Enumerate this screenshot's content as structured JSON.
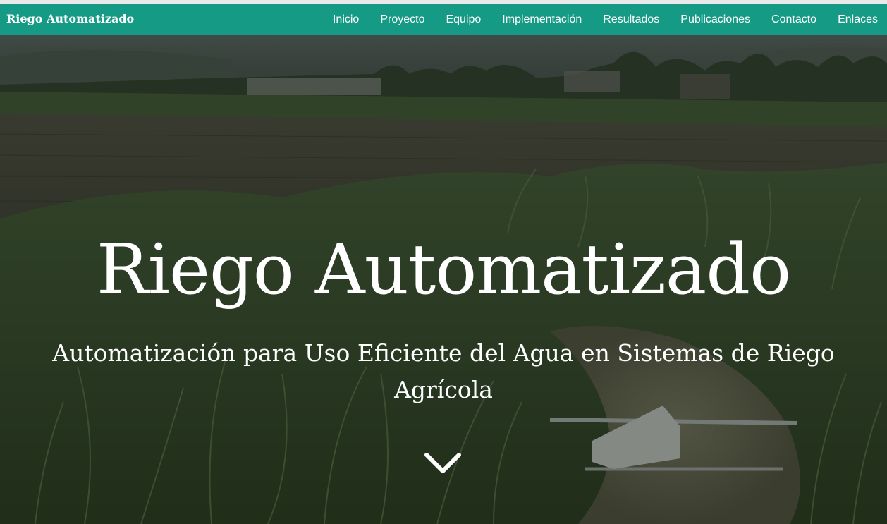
{
  "navbar": {
    "brand": "Riego Automatizado",
    "links": [
      {
        "label": "Inicio"
      },
      {
        "label": "Proyecto"
      },
      {
        "label": "Equipo"
      },
      {
        "label": "Implementación"
      },
      {
        "label": "Resultados"
      },
      {
        "label": "Publicaciones"
      },
      {
        "label": "Contacto"
      },
      {
        "label": "Enlaces"
      }
    ]
  },
  "hero": {
    "title": "Riego Automatizado",
    "subtitle": "Automatización para Uso Eficiente del Agua en Sistemas de Riego Agrícola",
    "scroll_icon": "chevron-down-icon",
    "background": "photo of a green agricultural field with tall grass and an irrigation pipe"
  },
  "colors": {
    "navbar": "#159a85",
    "text": "#ffffff",
    "overlay": "#1f281c"
  }
}
